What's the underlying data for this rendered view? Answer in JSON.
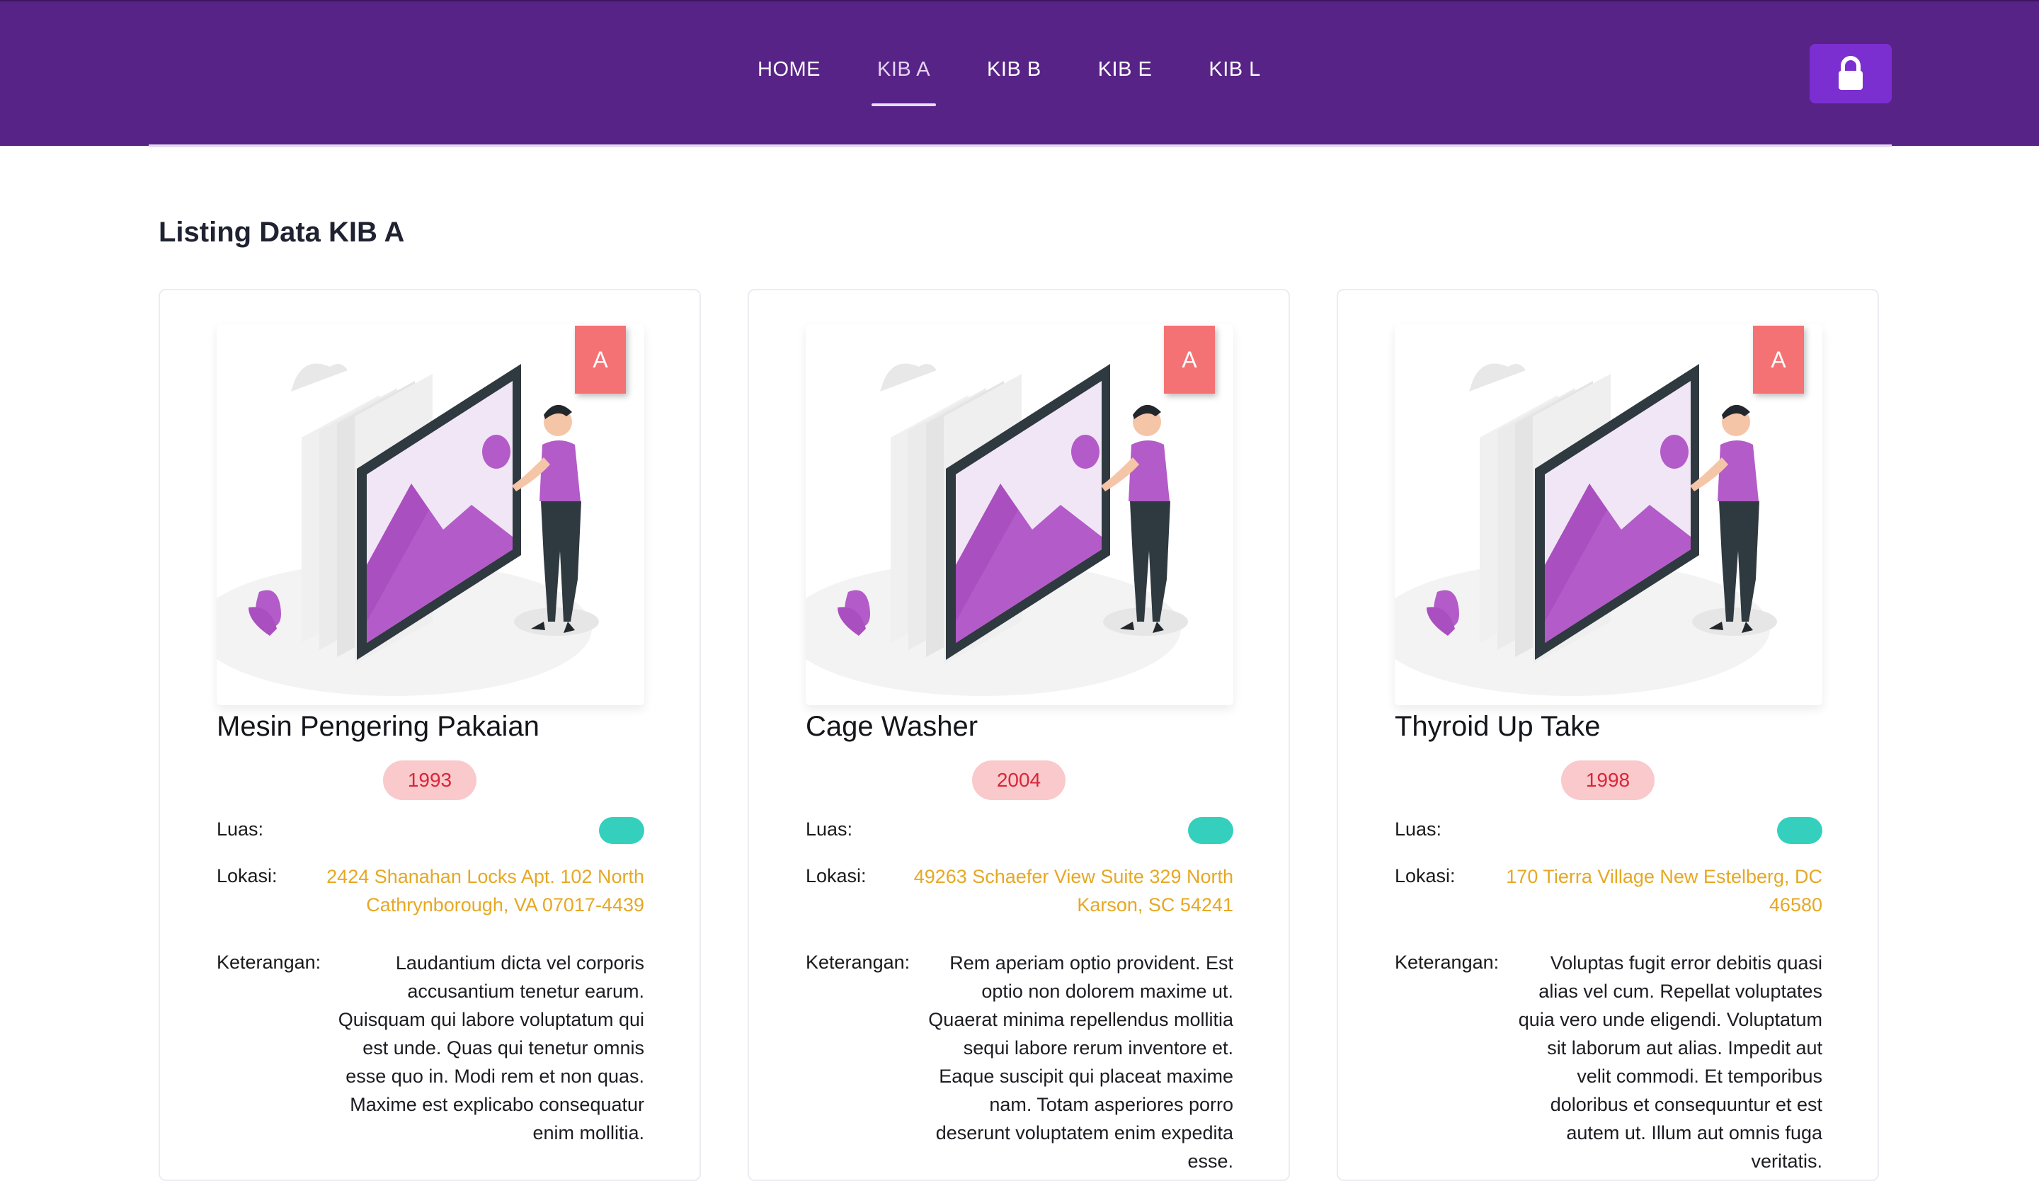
{
  "nav": {
    "items": [
      {
        "label": "HOME"
      },
      {
        "label": "KIB A"
      },
      {
        "label": "KIB B"
      },
      {
        "label": "KIB E"
      },
      {
        "label": "KIB L"
      }
    ],
    "active": "KIB A",
    "lock_icon": "lock-icon"
  },
  "page": {
    "title": "Listing Data KIB A"
  },
  "colors": {
    "navbar": "#572386",
    "lock_button": "#7b2fd0",
    "badge": "#f47273",
    "year_pill_bg": "#f9c9cb",
    "year_pill_text": "#d8263b",
    "luas_pill": "#35d0bd",
    "lokasi_text": "#e6a824",
    "illustration_accent": "#b35bc8"
  },
  "cards": [
    {
      "badge": "A",
      "title": "Mesin Pengering Pakaian",
      "year": "1993",
      "luas_label": "Luas:",
      "lokasi_label": "Lokasi:",
      "lokasi": "2424 Shanahan Locks Apt. 102 North Cathrynborough, VA 07017-4439",
      "keterangan_label": "Keterangan:",
      "keterangan": "Laudantium dicta vel corporis accusantium tenetur earum. Quisquam qui labore voluptatum qui est unde. Quas qui tenetur omnis esse quo in. Modi rem et non quas. Maxime est explicabo consequatur enim mollitia."
    },
    {
      "badge": "A",
      "title": "Cage Washer",
      "year": "2004",
      "luas_label": "Luas:",
      "lokasi_label": "Lokasi:",
      "lokasi": "49263 Schaefer View Suite 329 North Karson, SC 54241",
      "keterangan_label": "Keterangan:",
      "keterangan": "Rem aperiam optio provident. Est optio non dolorem maxime ut. Quaerat minima repellendus mollitia sequi labore rerum inventore et. Eaque suscipit qui placeat maxime nam. Totam asperiores porro deserunt voluptatem enim expedita esse."
    },
    {
      "badge": "A",
      "title": "Thyroid Up Take",
      "year": "1998",
      "luas_label": "Luas:",
      "lokasi_label": "Lokasi:",
      "lokasi": "170 Tierra Village New Estelberg, DC 46580",
      "keterangan_label": "Keterangan:",
      "keterangan": "Voluptas fugit error debitis quasi alias vel cum. Repellat voluptates quia vero unde eligendi. Voluptatum sit laborum aut alias. Impedit aut velit commodi. Et temporibus doloribus et consequuntur et est autem ut. Illum aut omnis fuga veritatis."
    }
  ]
}
